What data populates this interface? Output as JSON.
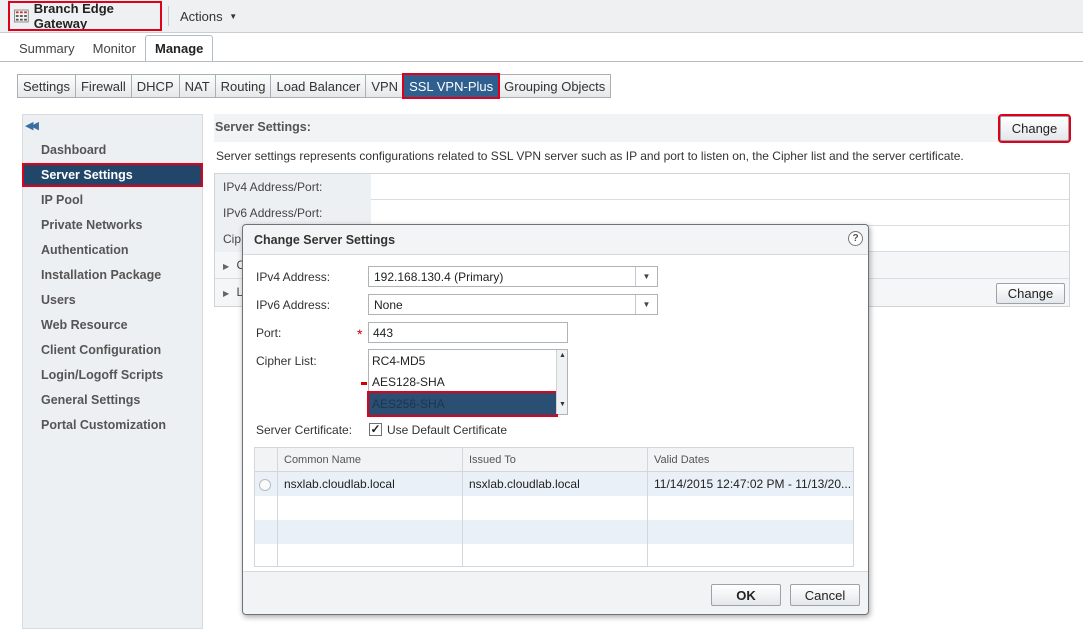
{
  "header": {
    "title": "Branch Edge Gateway",
    "actions_label": "Actions",
    "title_icon": "edge-gateway-icon"
  },
  "main_tabs": [
    {
      "label": "Summary"
    },
    {
      "label": "Monitor"
    },
    {
      "label": "Manage"
    }
  ],
  "sub_tabs": [
    {
      "label": "Settings"
    },
    {
      "label": "Firewall"
    },
    {
      "label": "DHCP"
    },
    {
      "label": "NAT"
    },
    {
      "label": "Routing"
    },
    {
      "label": "Load Balancer"
    },
    {
      "label": "VPN"
    },
    {
      "label": "SSL VPN-Plus"
    },
    {
      "label": "Grouping Objects"
    }
  ],
  "sidebar": {
    "collapse_icon": "double-chevron-left-icon",
    "items": [
      {
        "label": "Dashboard"
      },
      {
        "label": "Server Settings"
      },
      {
        "label": "IP Pool"
      },
      {
        "label": "Private Networks"
      },
      {
        "label": "Authentication"
      },
      {
        "label": "Installation Package"
      },
      {
        "label": "Users"
      },
      {
        "label": "Web Resource"
      },
      {
        "label": "Client Configuration"
      },
      {
        "label": "Login/Logoff Scripts"
      },
      {
        "label": "General Settings"
      },
      {
        "label": "Portal Customization"
      }
    ]
  },
  "content": {
    "title": "Server Settings:",
    "change_label": "Change",
    "description": "Server settings represents configurations related to SSL VPN server such as IP and port to listen on, the Cipher list and the server certificate.",
    "rows": [
      {
        "label": "IPv4 Address/Port:"
      },
      {
        "label": "IPv6 Address/Port:"
      },
      {
        "label": "Cip"
      }
    ],
    "expanders": [
      {
        "label": "C"
      },
      {
        "label": "L"
      }
    ],
    "change2_label": "Change"
  },
  "dialog": {
    "title": "Change Server Settings",
    "help_glyph": "?",
    "ipv4_label": "IPv4 Address:",
    "ipv4_value": "192.168.130.4 (Primary)",
    "ipv6_label": "IPv6 Address:",
    "ipv6_value": "None",
    "port_label": "Port:",
    "port_value": "443",
    "cipher_label": "Cipher List:",
    "ciphers": [
      {
        "label": "RC4-MD5",
        "selected": false
      },
      {
        "label": "AES128-SHA",
        "selected": false
      },
      {
        "label": "AES256-SHA",
        "selected": true
      }
    ],
    "cert_label": "Server Certificate:",
    "use_default_label": "Use Default Certificate",
    "use_default_checked": true,
    "grid": {
      "headers": [
        "Common Name",
        "Issued To",
        "Valid Dates"
      ],
      "rows": [
        {
          "common_name": "nsxlab.cloudlab.local",
          "issued_to": "nsxlab.cloudlab.local",
          "valid_dates": "11/14/2015 12:47:02 PM - 11/13/20..."
        }
      ]
    },
    "ok_label": "OK",
    "cancel_label": "Cancel"
  },
  "colors": {
    "highlight": "#e0001b",
    "selected_nav": "#22456a",
    "active_subtab": "#2f5f8f"
  }
}
